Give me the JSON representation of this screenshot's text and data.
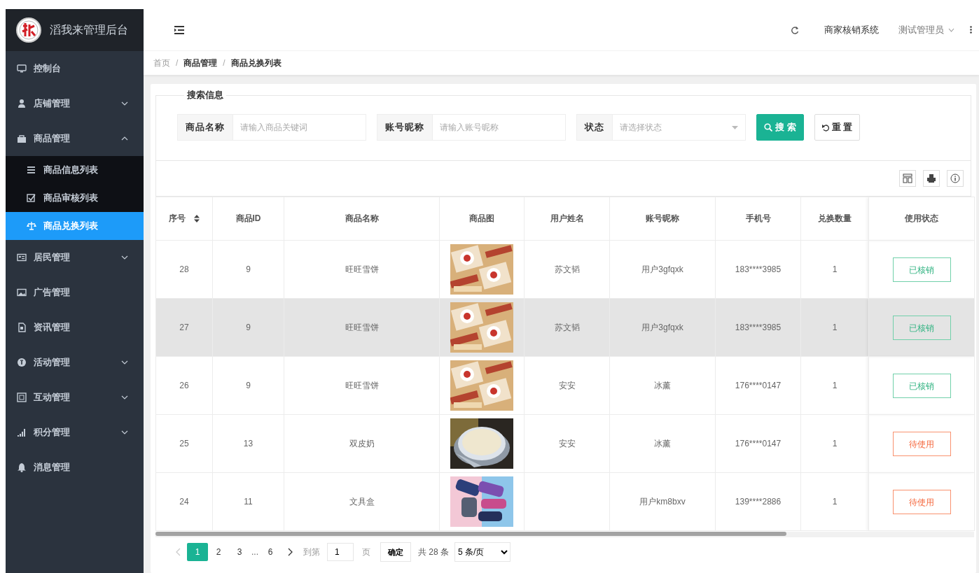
{
  "app": {
    "title": "滔我来管理后台"
  },
  "sidebar": {
    "items": [
      {
        "label": "控制台",
        "selected": false
      },
      {
        "label": "店铺管理",
        "selected": false,
        "expanded": false
      },
      {
        "label": "商品管理",
        "selected": false,
        "expanded": true,
        "children": [
          {
            "label": "商品信息列表",
            "selected": false
          },
          {
            "label": "商品审核列表",
            "selected": false
          },
          {
            "label": "商品兑换列表",
            "selected": true
          }
        ]
      },
      {
        "label": "居民管理",
        "selected": false,
        "expanded": false
      },
      {
        "label": "广告管理",
        "selected": false
      },
      {
        "label": "资讯管理",
        "selected": false
      },
      {
        "label": "活动管理",
        "selected": false,
        "expanded": false
      },
      {
        "label": "互动管理",
        "selected": false,
        "expanded": false
      },
      {
        "label": "积分管理",
        "selected": false,
        "expanded": false
      },
      {
        "label": "消息管理",
        "selected": false
      }
    ]
  },
  "header": {
    "system_link": "商家核销系统",
    "user": "测试管理员"
  },
  "breadcrumb": {
    "separator": "/",
    "items": [
      "首页",
      "商品管理",
      "商品兑换列表"
    ]
  },
  "search": {
    "legend": "搜索信息",
    "fields": [
      {
        "kind": "text",
        "label": "商品名称",
        "placeholder": "请输入商品关键词"
      },
      {
        "kind": "text",
        "label": "账号昵称",
        "placeholder": "请输入账号昵称"
      },
      {
        "kind": "select",
        "label": "状态",
        "placeholder": "请选择状态"
      }
    ],
    "buttons": [
      {
        "kind": "primary",
        "label": "搜 索"
      },
      {
        "kind": "default",
        "label": "重 置"
      }
    ]
  },
  "table": {
    "columns": [
      {
        "label": "序号",
        "sortable": true
      },
      {
        "label": "商品ID",
        "sortable": false
      },
      {
        "label": "商品名称",
        "sortable": false
      },
      {
        "label": "商品图",
        "sortable": false
      },
      {
        "label": "用户姓名",
        "sortable": false
      },
      {
        "label": "账号昵称",
        "sortable": false
      },
      {
        "label": "手机号",
        "sortable": false
      },
      {
        "label": "兑换数量",
        "sortable": false
      },
      {
        "label": "使用状态",
        "sortable": false
      }
    ],
    "rows": [
      {
        "hovered": false,
        "id": "28",
        "product_id": "9",
        "product_name": "旺旺雪饼",
        "user_name": "苏文韬",
        "nickname": "用户3gfqxk",
        "phone": "183****3985",
        "quantity": "1",
        "status": {
          "kind": "used",
          "label": "已核销"
        }
      },
      {
        "hovered": true,
        "id": "27",
        "product_id": "9",
        "product_name": "旺旺雪饼",
        "user_name": "苏文韬",
        "nickname": "用户3gfqxk",
        "phone": "183****3985",
        "quantity": "1",
        "status": {
          "kind": "used",
          "label": "已核销"
        }
      },
      {
        "hovered": false,
        "id": "26",
        "product_id": "9",
        "product_name": "旺旺雪饼",
        "user_name": "安安",
        "nickname": "冰薰",
        "phone": "176****0147",
        "quantity": "1",
        "status": {
          "kind": "used",
          "label": "已核销"
        }
      },
      {
        "hovered": false,
        "id": "25",
        "product_id": "13",
        "product_name": "双皮奶",
        "user_name": "安安",
        "nickname": "冰薰",
        "phone": "176****0147",
        "quantity": "1",
        "status": {
          "kind": "pending",
          "label": "待使用"
        }
      },
      {
        "hovered": false,
        "id": "24",
        "product_id": "11",
        "product_name": "文具盒",
        "nickname": "用户km8bxv",
        "phone": "139****2886",
        "quantity": "1",
        "status": {
          "kind": "pending",
          "label": "待使用"
        }
      }
    ]
  },
  "pagination": {
    "prev_disabled": true,
    "pages": [
      {
        "label": "1",
        "selected": true
      },
      {
        "label": "2",
        "selected": false
      },
      {
        "label": "3",
        "selected": false
      },
      {
        "label": "...",
        "kind": "ellipsis"
      },
      {
        "label": "6",
        "selected": false
      }
    ],
    "goto_label": "到第",
    "goto_value": "1",
    "page_unit": "页",
    "confirm": "确定",
    "total": "共 28 条",
    "page_size": "5 条/页"
  }
}
